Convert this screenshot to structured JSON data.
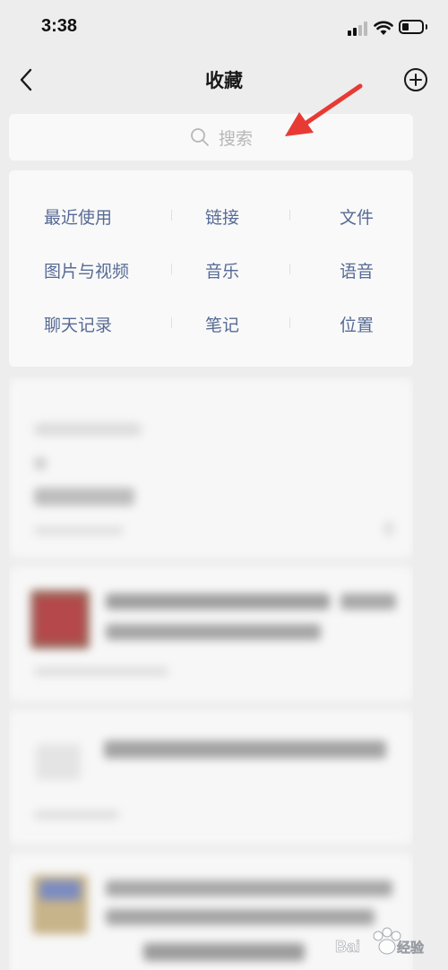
{
  "status_bar": {
    "time": "3:38"
  },
  "nav": {
    "title": "收藏"
  },
  "search": {
    "placeholder": "搜索"
  },
  "categories": [
    [
      "最近使用",
      "链接",
      "文件"
    ],
    [
      "图片与视频",
      "音乐",
      "语音"
    ],
    [
      "聊天记录",
      "笔记",
      "位置"
    ]
  ],
  "colors": {
    "link_blue": "#576b95",
    "annotation_red": "#e83a35",
    "background": "#ededed"
  },
  "watermark": {
    "brand": "Baidu 经验"
  }
}
